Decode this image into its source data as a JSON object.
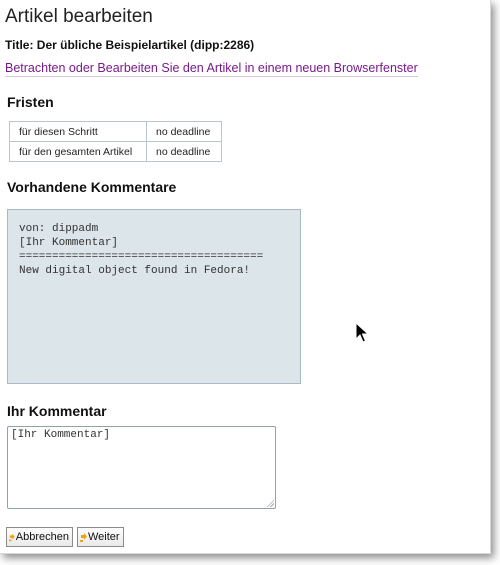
{
  "page": {
    "title": "Artikel bearbeiten",
    "article_title": "Title: Der übliche Beispielartikel (dipp:2286)",
    "open_link": "Betrachten oder Bearbeiten Sie den Artikel in einem neuen Browserfenster"
  },
  "deadlines": {
    "heading": "Fristen",
    "rows": [
      {
        "label": "für diesen Schritt",
        "value": "no deadline"
      },
      {
        "label": "für den gesamten Artikel",
        "value": "no deadline"
      }
    ]
  },
  "comments": {
    "heading": "Vorhandene Kommentare",
    "text": "von: dippadm\n[Ihr Kommentar]\n=====================================\nNew digital object found in Fedora!"
  },
  "your_comment": {
    "heading": "Ihr Kommentar",
    "value": "[Ihr Kommentar]"
  },
  "buttons": {
    "cancel": "Abbrechen",
    "next": "Weiter"
  },
  "icons": {
    "button_icon": "arrow-icon",
    "cursor": "mouse-pointer-icon"
  },
  "colors": {
    "link": "#7a1a8c",
    "comments_bg": "#dbe5ea",
    "button_icon": "#e8a317"
  }
}
